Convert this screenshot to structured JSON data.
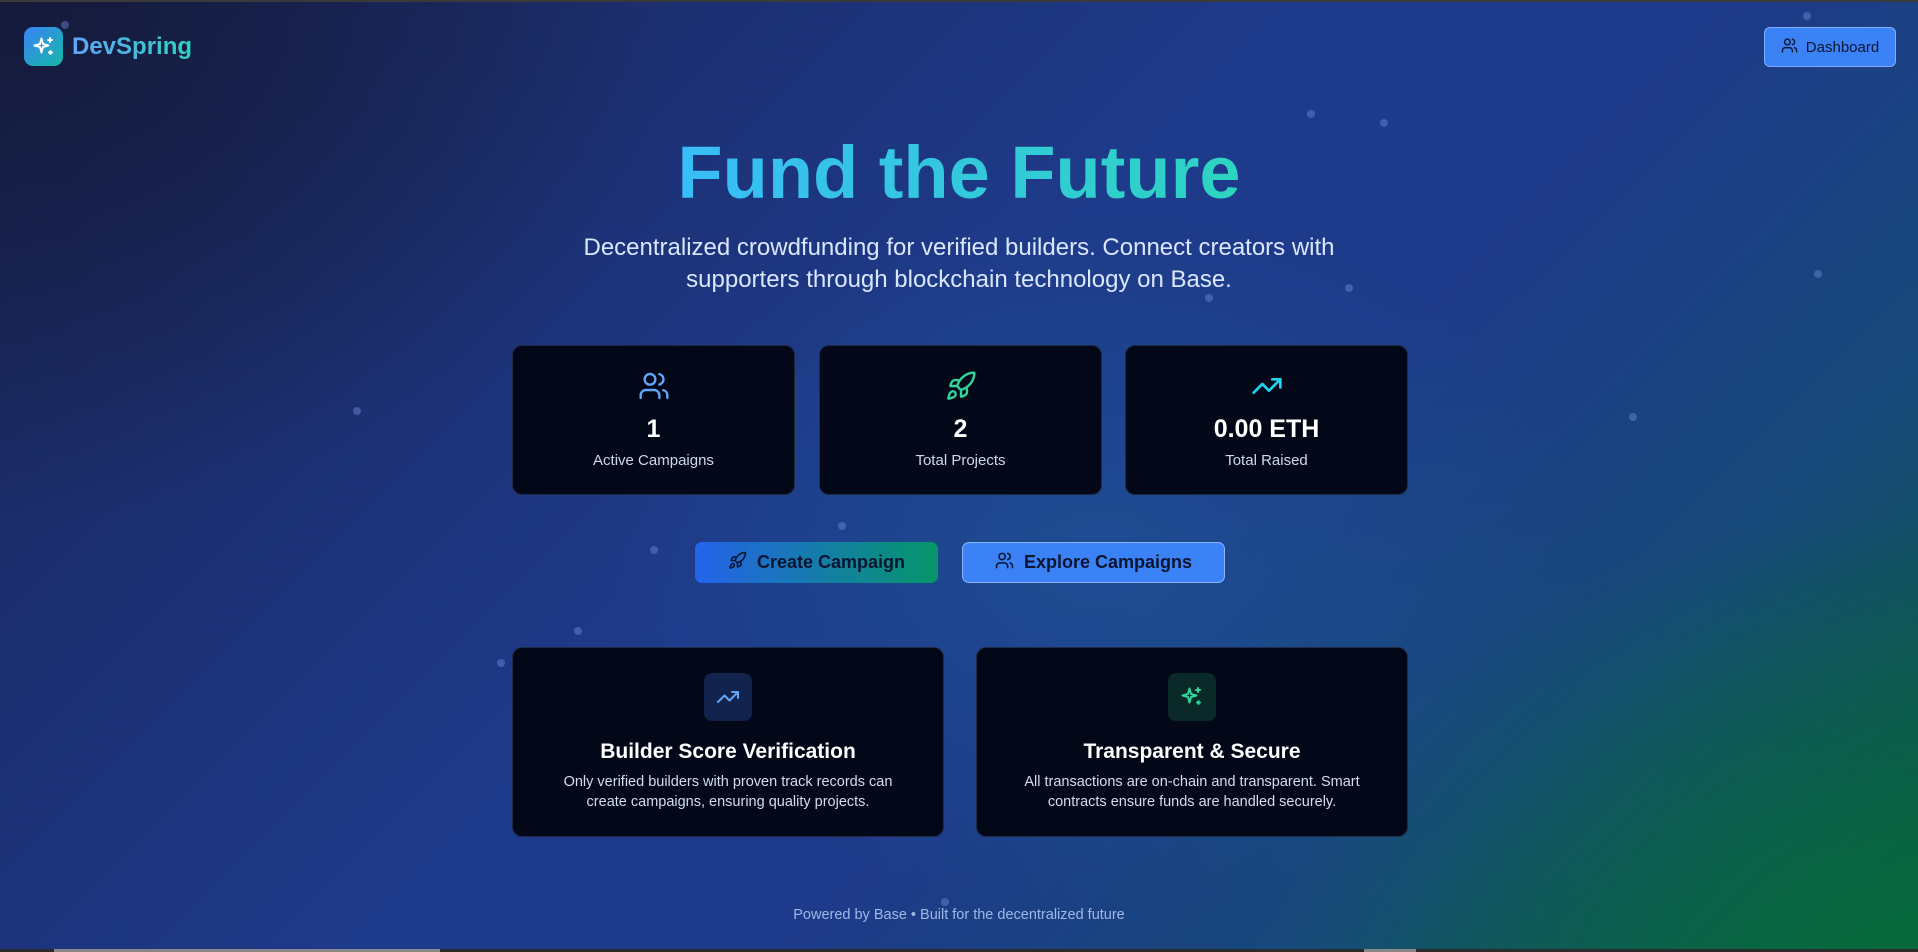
{
  "header": {
    "brand": "DevSpring",
    "brand_icon": "sparkles-icon",
    "dashboard_label": "Dashboard",
    "dashboard_icon": "users-icon"
  },
  "hero": {
    "title": "Fund the Future",
    "subtitle": "Decentralized crowdfunding for verified builders. Connect creators with supporters through blockchain technology on Base."
  },
  "stats": [
    {
      "icon": "users-icon",
      "value": "1",
      "label": "Active Campaigns"
    },
    {
      "icon": "rocket-icon",
      "value": "2",
      "label": "Total Projects"
    },
    {
      "icon": "trending-up-icon",
      "value": "0.00 ETH",
      "label": "Total Raised"
    }
  ],
  "actions": {
    "create_label": "Create Campaign",
    "create_icon": "rocket-icon",
    "explore_label": "Explore Campaigns",
    "explore_icon": "users-icon"
  },
  "features": [
    {
      "icon": "trending-up-icon",
      "title": "Builder Score Verification",
      "description": "Only verified builders with proven track records can create campaigns, ensuring quality projects."
    },
    {
      "icon": "sparkles-icon",
      "title": "Transparent & Secure",
      "description": "All transactions are on-chain and transparent. Smart contracts ensure funds are handled securely."
    }
  ],
  "footer": {
    "text": "Powered by Base • Built for the decentralized future"
  },
  "colors": {
    "accent_blue": "#3b82f6",
    "accent_teal": "#2dd4bf",
    "accent_green": "#059669",
    "card_bg": "#030818"
  }
}
